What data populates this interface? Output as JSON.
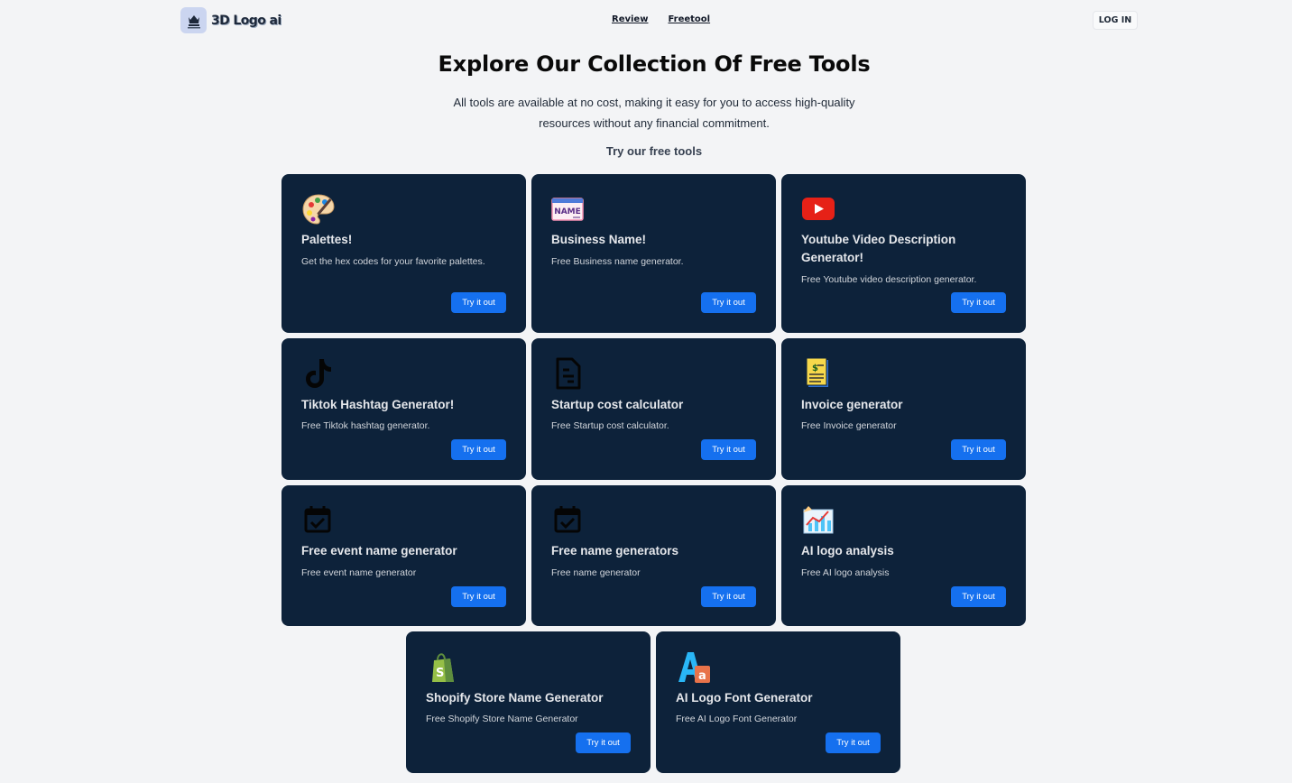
{
  "header": {
    "logo_text": "3D Logo ai",
    "nav": [
      "Review",
      "Freetool"
    ],
    "login_label": "LOG IN"
  },
  "hero": {
    "title": "Explore Our Collection Of Free Tools",
    "subtitle": "All tools are available at no cost, making it easy for you to access high-quality resources without any financial commitment.",
    "try_label": "Try our free tools"
  },
  "cards": [
    {
      "title": "Palettes!",
      "desc": "Get the hex codes for your favorite palettes.",
      "button": "Try it out",
      "icon": "palette-icon"
    },
    {
      "title": "Business Name!",
      "desc": "Free Business name generator.",
      "button": "Try it out",
      "icon": "name-tag-icon"
    },
    {
      "title": "Youtube Video Description Generator!",
      "desc": "Free Youtube video description generator.",
      "button": "Try it out",
      "icon": "youtube-icon"
    },
    {
      "title": "Tiktok Hashtag Generator!",
      "desc": "Free Tiktok hashtag generator.",
      "button": "Try it out",
      "icon": "tiktok-icon"
    },
    {
      "title": "Startup cost calculator",
      "desc": "Free Startup cost calculator.",
      "button": "Try it out",
      "icon": "document-icon"
    },
    {
      "title": "Invoice generator",
      "desc": "Free Invoice generator",
      "button": "Try it out",
      "icon": "invoice-icon"
    },
    {
      "title": "Free event name generator",
      "desc": "Free event name generator",
      "button": "Try it out",
      "icon": "calendar-check-icon"
    },
    {
      "title": "Free name generators",
      "desc": "Free name generator",
      "button": "Try it out",
      "icon": "calendar-check-icon"
    },
    {
      "title": "AI logo analysis",
      "desc": "Free AI logo analysis",
      "button": "Try it out",
      "icon": "chart-icon"
    },
    {
      "title": "Shopify Store Name Generator",
      "desc": "Free Shopify Store Name Generator",
      "button": "Try it out",
      "icon": "shopify-bag-icon"
    },
    {
      "title": "AI Logo Font Generator",
      "desc": "Free AI Logo Font Generator",
      "button": "Try it out",
      "icon": "font-icon"
    }
  ],
  "colors": {
    "page_bg": "#f3f4f6",
    "card_bg": "#0d223a",
    "button_bg": "#1570ef"
  }
}
